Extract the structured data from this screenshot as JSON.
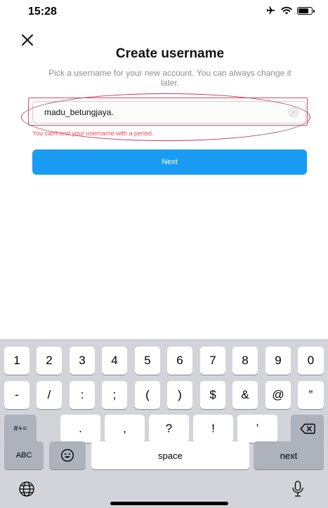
{
  "status_bar": {
    "time": "15:28"
  },
  "header": {
    "title": "Create username",
    "subtitle": "Pick a username for your new account. You can always change it later."
  },
  "username": {
    "value": "madu_betungjaya.",
    "error": "You can't end your username with a period."
  },
  "next_button": {
    "label": "Next"
  },
  "keyboard": {
    "row1": [
      "1",
      "2",
      "3",
      "4",
      "5",
      "6",
      "7",
      "8",
      "9",
      "0"
    ],
    "row2": [
      "-",
      "/",
      ":",
      ";",
      "(",
      ")",
      "$",
      "&",
      "@",
      "”"
    ],
    "row3": {
      "mode_key": "#+=",
      "keys": [
        ".",
        ",",
        "?",
        "!",
        "’"
      ]
    },
    "row4": {
      "abc_key": "ABC",
      "space": "space",
      "return_key": "next"
    }
  },
  "colors": {
    "accent": "#1a9bf4",
    "error": "#ed4956",
    "annotation": "#d94a5f"
  }
}
